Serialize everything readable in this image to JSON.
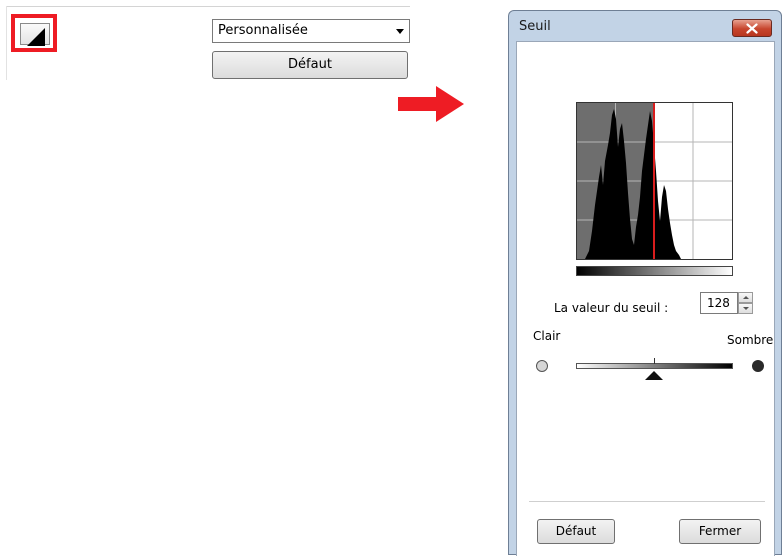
{
  "left_panel": {
    "preset_select": {
      "value": "Personnalisée"
    },
    "default_button": "Défaut"
  },
  "dialog": {
    "title": "Seuil",
    "threshold_label": "La valeur du seuil :",
    "threshold_value": "128",
    "light_label": "Clair",
    "dark_label": "Sombre",
    "default_button": "Défaut",
    "close_button": "Fermer",
    "threshold_fraction": 0.5
  },
  "colors": {
    "highlight": "#ee1c24",
    "title_bar": "#c2d3e6",
    "close_button": "#c7462e",
    "threshold_line": "#d81d1d"
  }
}
